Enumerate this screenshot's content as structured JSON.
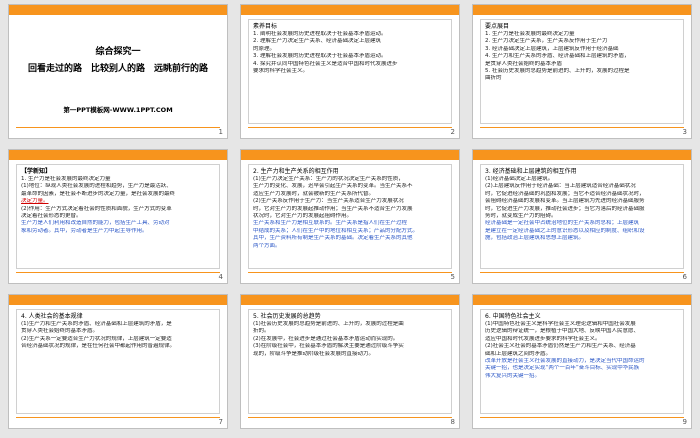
{
  "slides": [
    {
      "number": "1",
      "title_main": "综合探究一",
      "title_sub": "回看走过的路　比较别人的路　远眺前行的路",
      "site": "第一PPT模板网-WWW.1PPT.COM"
    },
    {
      "number": "2",
      "heading": "素养目标",
      "lines": [
        "1. 阐明社会发展的历史进程取决于社会基本矛盾运动。",
        "2. 理解生产力决定生产关系、经济基础决定上层建筑",
        "的原理。",
        "3. 理解社会发展的历史进程取决于社会基本矛盾运动。",
        "4. 探究并认同中国特色社会主义是适合中国和时代发展进步",
        "要求的科学社会主义。"
      ]
    },
    {
      "number": "3",
      "heading": "要点展目",
      "lines": [
        "1. 生产力是社会发展的最终决定力量",
        "2. 生产力决定生产关系，生产关系反作用于生产力",
        "3. 经济基础决定上层建筑，上层建筑反作用于经济基础",
        "4. 生产力和生产关系的矛盾、经济基础和上层建筑的矛盾，",
        "是贯穿人类社会始终的基本矛盾",
        "5. 社会历史发展的总趋势是前进的、上升的，发展的过程是",
        "曲折的"
      ]
    },
    {
      "number": "4",
      "heading": "【学新知】",
      "lines": [
        "1. 生产力是社会发展的最终决定力量",
        "(1)地位：纵观人类社会发展的进程和趋势，生产力是最活跃、",
        "最革命的因素，是社会不断进步的决定力量，是社会发展的最终",
        "决定力量。",
        "(2)作用：生产方式决定着社会的性质和面貌，生产方式的变革",
        "决定着社会形态的更替。",
        "生产力是人们利用和改造自然的能力，包括生产工具、劳动对",
        "象和劳动者。其中，劳动者是生产力中起主导作用。"
      ]
    },
    {
      "number": "5",
      "heading": "2. 生产力和生产关系的相互作用",
      "lines": [
        "(1)生产力决定生产关系：生产力的状况决定生产关系的性质，",
        "生产力的变化、发展，迟早会引起生产关系的变革。当生产关系不",
        "适应生产力发展时，就会被新的生产关系所代替。",
        "(2)生产关系反作用于生产力：当生产关系适合生产力发展状况",
        "时，它对生产力的发展起推动作用；当生产关系不适合生产力发展",
        "状况时，它对生产力的发展起阻碍作用。",
        "生产关系和生产力是相互联系的。生产关系是指人们在生产过程",
        "中结成的关系；人们在生产中的地位和相互关系；产品的分配方式。",
        "其中，生产资料所有制是生产关系的基础。决定着生产关系的其他",
        "两个方面。"
      ]
    },
    {
      "number": "6",
      "heading": "3. 经济基础和上层建筑的相互作用",
      "lines": [
        "(1)经济基础决定上层建筑。",
        "(2)上层建筑反作用于经济基础：当上层建筑适合经济基础状况",
        "时，它促进经济基础的巩固和发展；当它不适合经济基础状况时，",
        "会阻碍经济基础的发展和变革。当上层建筑为先进的经济基础服务",
        "时，它促进生产力发展，推动社会进步；当它为落后的经济基础服",
        "务时，就变成生产力的阻碍。",
        "经济基础是一定社会中占统治地位的生产关系的总和；上层建筑",
        "是建立在一定经济基础之上的意识形态以及相应的制度、组织和设",
        "施，包括政治上层建筑和思想上层建筑。"
      ]
    },
    {
      "number": "7",
      "heading": "4. 人类社会的基本规律",
      "lines": [
        "(1)生产力和生产关系的矛盾、经济基础和上层建筑的矛盾，是",
        "贯穿人类社会始终的基本矛盾。",
        "(2)生产关系一定要适合生产力状况的规律，上层建筑一定要适",
        "合经济基础状况的规律，是在任何社会中都起作用的普遍规律。"
      ]
    },
    {
      "number": "8",
      "heading": "5. 社会历史发展的总趋势",
      "lines": [
        "(1)社会历史发展的总趋势是前进的、上升的，发展的过程是曲",
        "折的。",
        "(2)在发展中，社会进步是通过社会基本矛盾运动而实现的。",
        "(3)在阶级社会中，社会基本矛盾的解决主要是通过阶级斗争实",
        "现的，阶级斗争是推动阶级社会发展的直接动力。"
      ]
    },
    {
      "number": "9",
      "heading": "6. 中国特色社会主义",
      "lines": [
        "(1)中国特色社会主义是科学社会主义理论逻辑和中国社会发展",
        "历史逻辑的辩证统一，是根植于中国大地、反映中国人民意愿、",
        "适应中国和时代发展进步要求的科学社会主义。",
        "(2)社会主义社会的基本矛盾仍然是生产力和生产关系、经济基",
        "础和上层建筑之间的矛盾。",
        "改革开放是社会主义社会发展的直接动力，是决定当代中国命运的",
        "关键一招，也是决定实现“两个一百年”奋斗目标、实现中华民族",
        "伟大复兴的关键一招。"
      ]
    }
  ]
}
